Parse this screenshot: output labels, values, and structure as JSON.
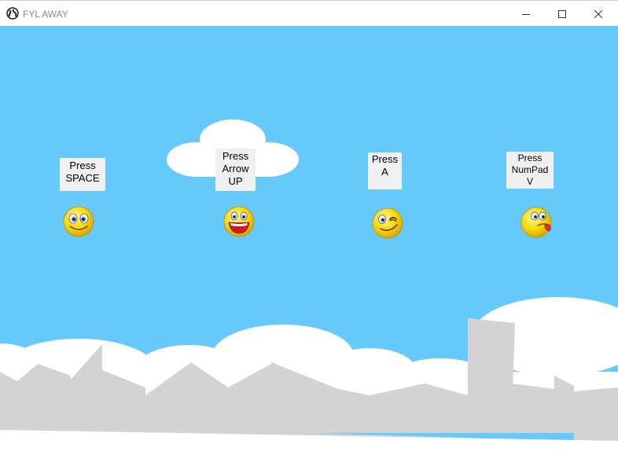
{
  "window": {
    "title": "FYL AWAY",
    "app_icon": "globe-icon",
    "controls": [
      "minimize-icon",
      "maximize-icon",
      "close-icon"
    ]
  },
  "colors": {
    "sky": "#66C9FC",
    "cloud": "#FFFFFF",
    "buildings": "#D3D3D3",
    "prompt_bg": "#F0F0F0",
    "smiley": "#F5D90A",
    "tongue": "#E0302A"
  },
  "controls": [
    {
      "id": "space",
      "lines": [
        "Press",
        "SPACE"
      ],
      "smiley": "smiling-face-icon"
    },
    {
      "id": "up",
      "lines": [
        "Press",
        "Arrow",
        "UP"
      ],
      "smiley": "laughing-face-icon"
    },
    {
      "id": "a",
      "lines": [
        "Press",
        "A"
      ],
      "smiley": "winking-face-icon"
    },
    {
      "id": "numpad",
      "lines": [
        "Press",
        "NumPad",
        "V"
      ],
      "smiley": "tongue-out-face-icon"
    }
  ]
}
